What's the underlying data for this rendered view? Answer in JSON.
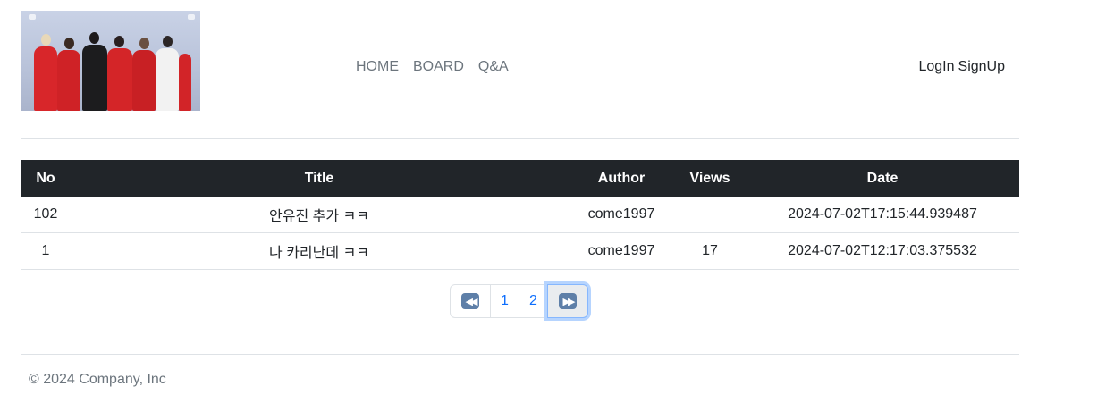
{
  "header": {
    "logo_alt": "group photo",
    "nav": [
      "HOME",
      "BOARD",
      "Q&A"
    ],
    "auth": {
      "login": "LogIn",
      "signup": "SignUp"
    }
  },
  "table": {
    "columns": {
      "no": "No",
      "title": "Title",
      "author": "Author",
      "views": "Views",
      "date": "Date"
    },
    "rows": [
      {
        "no": "102",
        "title": "안유진 추가 ㅋㅋ",
        "author": "come1997",
        "views": "",
        "date": "2024-07-02T17:15:44.939487"
      },
      {
        "no": "1",
        "title": "나 카리난데 ㅋㅋ",
        "author": "come1997",
        "views": "17",
        "date": "2024-07-02T12:17:03.375532"
      }
    ]
  },
  "pagination": {
    "first_icon": "fast-backward-icon",
    "pages": [
      "1",
      "2"
    ],
    "last_icon": "fast-forward-icon",
    "arrow_color": "#5e7fa8"
  },
  "footer": {
    "text": "© 2024 Company, Inc"
  }
}
